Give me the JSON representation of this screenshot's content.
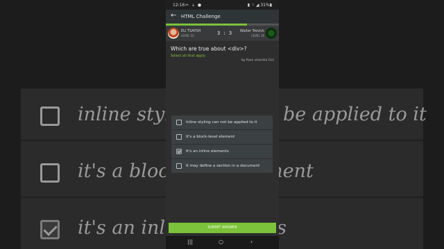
{
  "background_zoom": {
    "options": [
      {
        "text": "inline styling can not be applied to it",
        "checked": false
      },
      {
        "text": "it's a block-level element",
        "checked": false
      },
      {
        "text": "it's an inline elements",
        "checked": true
      }
    ]
  },
  "statusbar": {
    "time": "12:16",
    "icons": "✂ ⇣ ●",
    "right": "▮ ⁙ ◢ 31%▮"
  },
  "appbar": {
    "back_icon": "←",
    "title": "HTML Challenge"
  },
  "progress": {
    "value": 0.72,
    "color": "#7cc23a"
  },
  "players": {
    "left": {
      "name": "ELI TSAYSH",
      "level": "LEVEL 10"
    },
    "score": "3 : 3",
    "right": {
      "name": "Walter Trevick",
      "level": "LEVEL 16"
    }
  },
  "question": {
    "text": "Which are true about <div>?",
    "hint": "Select all that apply",
    "author": "by Ram chandra Giri"
  },
  "options": [
    {
      "text": "Inline styling can not be applied to it",
      "checked": false
    },
    {
      "text": "It's a block-level element",
      "checked": false
    },
    {
      "text": "It's an inline elements",
      "checked": true
    },
    {
      "text": "It may define a section in a document",
      "checked": false
    }
  ],
  "submit_label": "SUBMIT ANSWER",
  "navbar": {
    "recent": "|||",
    "home": "○",
    "back": "‹"
  },
  "colors": {
    "accent": "#7cc23a",
    "card": "#3b4042",
    "screen": "#2e2e2e"
  }
}
